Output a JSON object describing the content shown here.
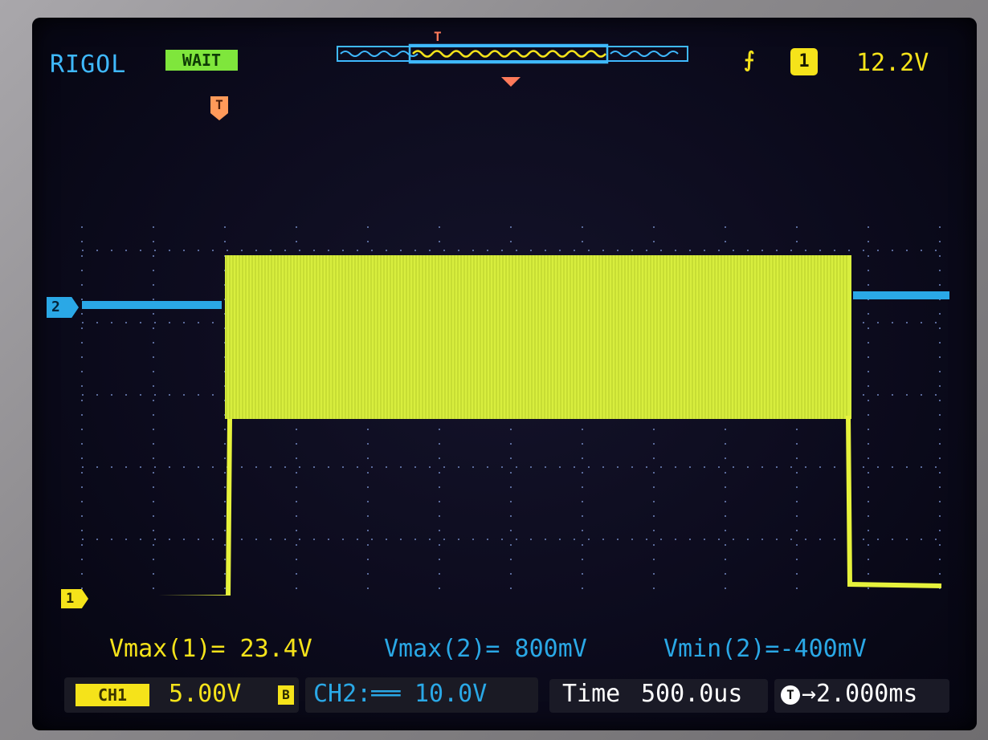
{
  "header": {
    "brand": "RIGOL",
    "run_status": "WAIT",
    "trigger_marker": "T",
    "memory_trigger_marker": "T",
    "trigger_edge_icon": "rising-edge-icon",
    "trigger_source": "1",
    "trigger_level": "12.2V"
  },
  "channels": {
    "ch1_marker": "1",
    "ch2_marker": "2",
    "ch1_color": "#f5e31a",
    "ch2_color": "#2aa8e6"
  },
  "measurements": {
    "vmax1": "Vmax(1)= 23.4V",
    "vmax2": "Vmax(2)= 800mV",
    "vmin2": "Vmin(2)=-400mV"
  },
  "bottom_bar": {
    "ch1_label": "CH1",
    "ch1_scale": "5.00V",
    "ch1_bw_icon": "B",
    "ch2_label": "CH2:══",
    "ch2_scale": "10.0V",
    "timebase_label": "Time",
    "timebase_value": "500.0us",
    "trigger_offset_icon": "T",
    "trigger_offset_value": "→2.000ms"
  }
}
